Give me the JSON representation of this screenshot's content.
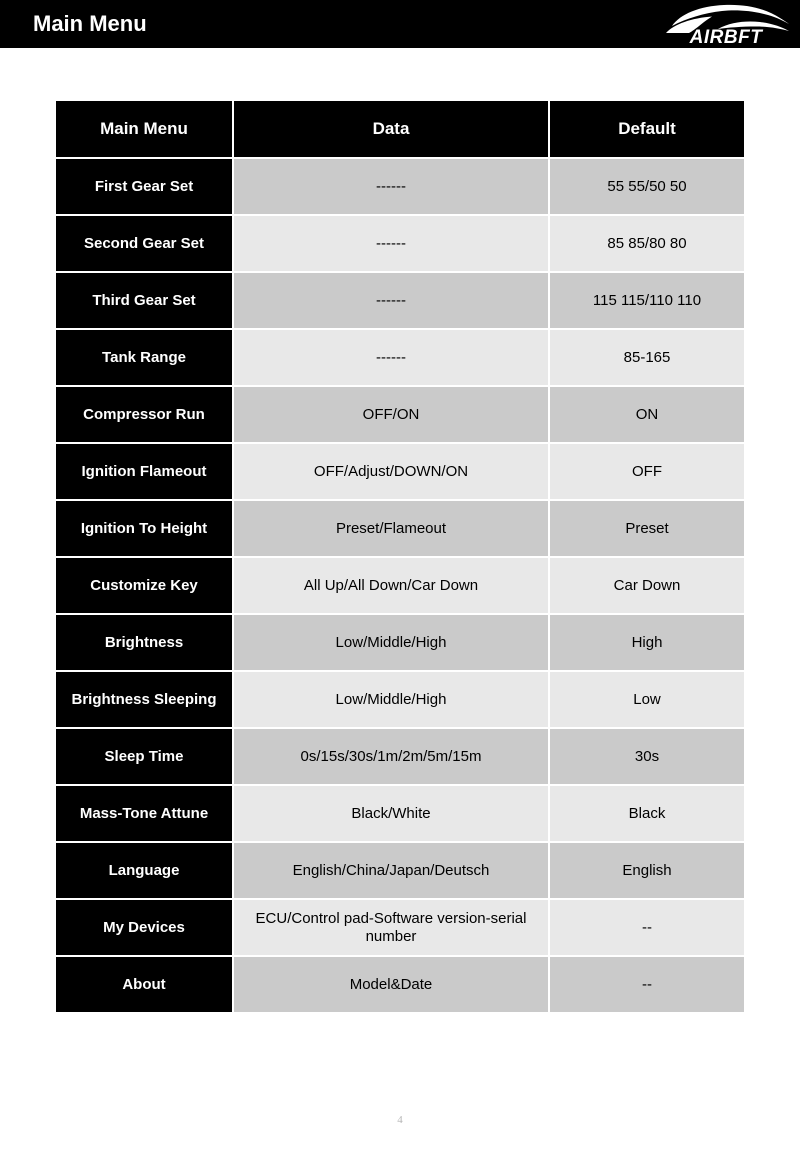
{
  "header": {
    "title": "Main Menu",
    "logo_text": "AIRBFT",
    "logo_icon": "car-silhouette-icon",
    "background": "#000000",
    "text_color": "#ffffff"
  },
  "table": {
    "columns": [
      "Main Menu",
      "Data",
      "Default"
    ],
    "rows": [
      {
        "label": "First Gear Set",
        "data": "------",
        "default": "55 55/50 50",
        "shade": "dark"
      },
      {
        "label": "Second Gear Set",
        "data": "------",
        "default": "85 85/80 80",
        "shade": "light"
      },
      {
        "label": "Third Gear Set",
        "data": "------",
        "default": "115 115/110 110",
        "shade": "dark"
      },
      {
        "label": "Tank Range",
        "data": "------",
        "default": "85-165",
        "shade": "light"
      },
      {
        "label": "Compressor Run",
        "data": "OFF/ON",
        "default": "ON",
        "shade": "dark"
      },
      {
        "label": "Ignition Flameout",
        "data": "OFF/Adjust/DOWN/ON",
        "default": "OFF",
        "shade": "light"
      },
      {
        "label": "Ignition To Height",
        "data": "Preset/Flameout",
        "default": "Preset",
        "shade": "dark"
      },
      {
        "label": "Customize Key",
        "data": "All Up/All Down/Car Down",
        "default": "Car Down",
        "shade": "light"
      },
      {
        "label": "Brightness",
        "data": "Low/Middle/High",
        "default": "High",
        "shade": "dark"
      },
      {
        "label": "Brightness Sleeping",
        "data": "Low/Middle/High",
        "default": "Low",
        "shade": "light"
      },
      {
        "label": "Sleep Time",
        "data": "0s/15s/30s/1m/2m/5m/15m",
        "default": "30s",
        "shade": "dark"
      },
      {
        "label": "Mass-Tone Attune",
        "data": "Black/White",
        "default": "Black",
        "shade": "light"
      },
      {
        "label": "Language",
        "data": "English/China/Japan/Deutsch",
        "default": "English",
        "shade": "dark"
      },
      {
        "label": "My Devices",
        "data": "ECU/Control pad-Software version-serial number",
        "default": "--",
        "shade": "light"
      },
      {
        "label": "About",
        "data": "Model&Date",
        "default": "--",
        "shade": "dark"
      }
    ],
    "colors": {
      "header_cell": "#000000",
      "label_cell": "#000000",
      "row_shade_dark": "#cacaca",
      "row_shade_light": "#e8e8e8",
      "grid_gap": "#ffffff"
    }
  },
  "footer": {
    "page_number": "4"
  }
}
